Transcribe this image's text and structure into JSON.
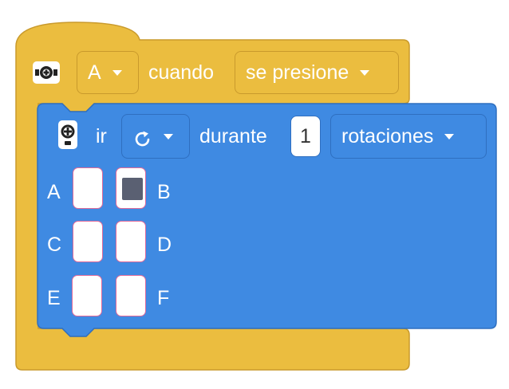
{
  "colors": {
    "event_block": "#ebbd3f",
    "motor_block": "#3f8ae2",
    "port_selected": "#5a6072"
  },
  "event_block": {
    "icon": "button-hub-icon",
    "port_value": "A",
    "label_when": "cuando",
    "condition_value": "se presione"
  },
  "motor_block": {
    "icon": "motor-icon",
    "label_go": "ir",
    "direction_icon": "clockwise-arrow-icon",
    "label_for": "durante",
    "amount": "1",
    "unit_value": "rotaciones",
    "ports": [
      {
        "label": "A",
        "selected": false
      },
      {
        "label": "B",
        "selected": true
      },
      {
        "label": "C",
        "selected": false
      },
      {
        "label": "D",
        "selected": false
      },
      {
        "label": "E",
        "selected": false
      },
      {
        "label": "F",
        "selected": false
      }
    ]
  }
}
